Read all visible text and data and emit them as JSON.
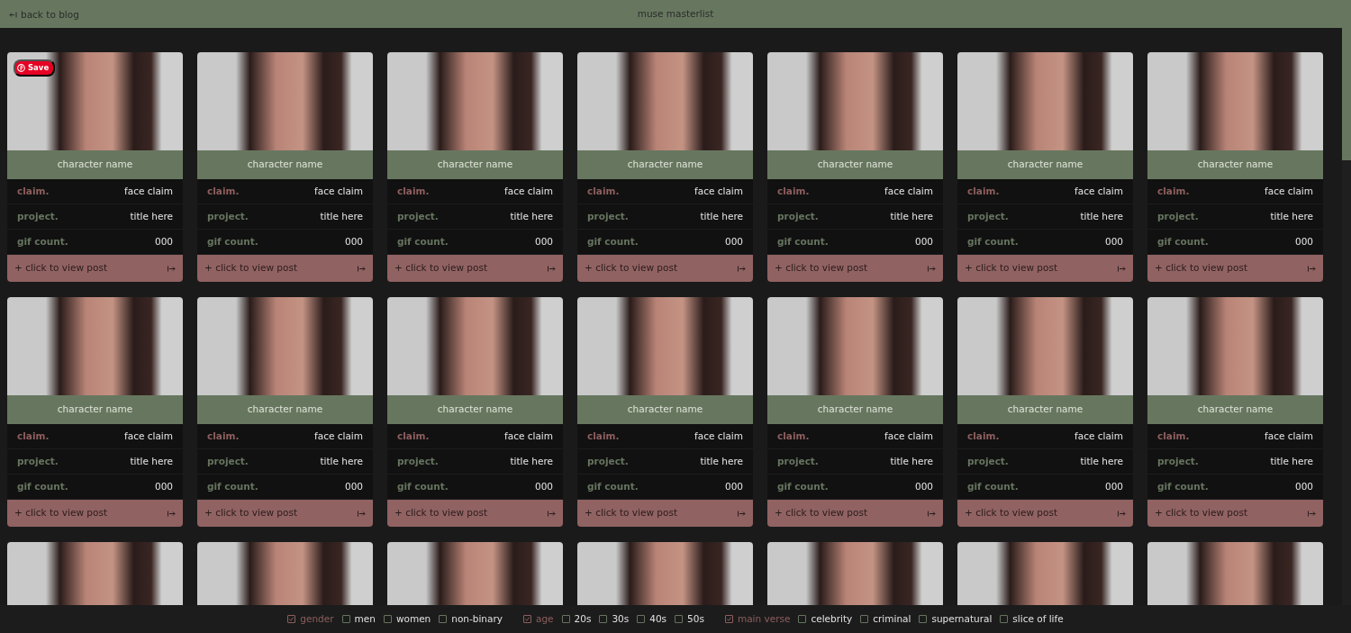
{
  "header": {
    "back_link": "back to blog",
    "title": "muse masterlist"
  },
  "pin_save": {
    "label": "Save"
  },
  "cards": [
    {
      "kind": "full",
      "name": "character name",
      "rows": [
        {
          "label": "claim.",
          "value": "face claim",
          "color": "#8e5e5e"
        },
        {
          "label": "project.",
          "value": "title here",
          "color": "#66745f"
        },
        {
          "label": "gif count.",
          "value": "000",
          "color": "#66745f"
        }
      ],
      "link": "+ click to view post"
    },
    {
      "kind": "full",
      "name": "character name",
      "rows": [
        {
          "label": "claim.",
          "value": "face claim",
          "color": "#8e5e5e"
        },
        {
          "label": "project.",
          "value": "title here",
          "color": "#66745f"
        },
        {
          "label": "gif count.",
          "value": "000",
          "color": "#66745f"
        }
      ],
      "link": "+ click to view post"
    },
    {
      "kind": "full",
      "name": "character name",
      "rows": [
        {
          "label": "claim.",
          "value": "face claim",
          "color": "#8e5e5e"
        },
        {
          "label": "project.",
          "value": "title here",
          "color": "#66745f"
        },
        {
          "label": "gif count.",
          "value": "000",
          "color": "#66745f"
        }
      ],
      "link": "+ click to view post"
    },
    {
      "kind": "full",
      "name": "character name",
      "rows": [
        {
          "label": "claim.",
          "value": "face claim",
          "color": "#8e5e5e"
        },
        {
          "label": "project.",
          "value": "title here",
          "color": "#66745f"
        },
        {
          "label": "gif count.",
          "value": "000",
          "color": "#66745f"
        }
      ],
      "link": "+ click to view post"
    },
    {
      "kind": "full",
      "name": "character name",
      "rows": [
        {
          "label": "claim.",
          "value": "face claim",
          "color": "#8e5e5e"
        },
        {
          "label": "project.",
          "value": "title here",
          "color": "#66745f"
        },
        {
          "label": "gif count.",
          "value": "000",
          "color": "#66745f"
        }
      ],
      "link": "+ click to view post"
    },
    {
      "kind": "full",
      "name": "character name",
      "rows": [
        {
          "label": "claim.",
          "value": "face claim",
          "color": "#8e5e5e"
        },
        {
          "label": "project.",
          "value": "title here",
          "color": "#66745f"
        },
        {
          "label": "gif count.",
          "value": "000",
          "color": "#66745f"
        }
      ],
      "link": "+ click to view post"
    },
    {
      "kind": "full",
      "name": "character name",
      "rows": [
        {
          "label": "claim.",
          "value": "face claim",
          "color": "#8e5e5e"
        },
        {
          "label": "project.",
          "value": "title here",
          "color": "#66745f"
        },
        {
          "label": "gif count.",
          "value": "000",
          "color": "#66745f"
        }
      ],
      "link": "+ click to view post"
    },
    {
      "kind": "full",
      "name": "character name",
      "rows": [
        {
          "label": "claim.",
          "value": "face claim",
          "color": "#8e5e5e"
        },
        {
          "label": "project.",
          "value": "title here",
          "color": "#66745f"
        },
        {
          "label": "gif count.",
          "value": "000",
          "color": "#66745f"
        }
      ],
      "link": "+ click to view post"
    },
    {
      "kind": "full",
      "name": "character name",
      "rows": [
        {
          "label": "claim.",
          "value": "face claim",
          "color": "#8e5e5e"
        },
        {
          "label": "project.",
          "value": "title here",
          "color": "#66745f"
        },
        {
          "label": "gif count.",
          "value": "000",
          "color": "#66745f"
        }
      ],
      "link": "+ click to view post"
    },
    {
      "kind": "full",
      "name": "character name",
      "rows": [
        {
          "label": "claim.",
          "value": "face claim",
          "color": "#8e5e5e"
        },
        {
          "label": "project.",
          "value": "title here",
          "color": "#66745f"
        },
        {
          "label": "gif count.",
          "value": "000",
          "color": "#66745f"
        }
      ],
      "link": "+ click to view post"
    },
    {
      "kind": "full",
      "name": "character name",
      "rows": [
        {
          "label": "claim.",
          "value": "face claim",
          "color": "#8e5e5e"
        },
        {
          "label": "project.",
          "value": "title here",
          "color": "#66745f"
        },
        {
          "label": "gif count.",
          "value": "000",
          "color": "#66745f"
        }
      ],
      "link": "+ click to view post"
    },
    {
      "kind": "full",
      "name": "character name",
      "rows": [
        {
          "label": "claim.",
          "value": "face claim",
          "color": "#8e5e5e"
        },
        {
          "label": "project.",
          "value": "title here",
          "color": "#66745f"
        },
        {
          "label": "gif count.",
          "value": "000",
          "color": "#66745f"
        }
      ],
      "link": "+ click to view post"
    },
    {
      "kind": "full",
      "name": "character name",
      "rows": [
        {
          "label": "claim.",
          "value": "face claim",
          "color": "#8e5e5e"
        },
        {
          "label": "project.",
          "value": "title here",
          "color": "#66745f"
        },
        {
          "label": "gif count.",
          "value": "000",
          "color": "#66745f"
        }
      ],
      "link": "+ click to view post"
    },
    {
      "kind": "full",
      "name": "character name",
      "rows": [
        {
          "label": "claim.",
          "value": "face claim",
          "color": "#8e5e5e"
        },
        {
          "label": "project.",
          "value": "title here",
          "color": "#66745f"
        },
        {
          "label": "gif count.",
          "value": "000",
          "color": "#66745f"
        }
      ],
      "link": "+ click to view post"
    },
    {
      "kind": "photo_only"
    },
    {
      "kind": "photo_only"
    },
    {
      "kind": "photo_only"
    },
    {
      "kind": "photo_only"
    },
    {
      "kind": "photo_only"
    },
    {
      "kind": "photo_only"
    },
    {
      "kind": "photo_only"
    }
  ],
  "filters": [
    {
      "kind": "group",
      "label": "gender",
      "checked": true
    },
    {
      "kind": "option",
      "label": "men",
      "checked": false
    },
    {
      "kind": "option",
      "label": "women",
      "checked": false
    },
    {
      "kind": "option",
      "label": "non-binary",
      "checked": false
    },
    {
      "kind": "group",
      "label": "age",
      "checked": true
    },
    {
      "kind": "option",
      "label": "20s",
      "checked": false
    },
    {
      "kind": "option",
      "label": "30s",
      "checked": false
    },
    {
      "kind": "option",
      "label": "40s",
      "checked": false
    },
    {
      "kind": "option",
      "label": "50s",
      "checked": false
    },
    {
      "kind": "group",
      "label": "main verse",
      "checked": true
    },
    {
      "kind": "option",
      "label": "celebrity",
      "checked": false
    },
    {
      "kind": "option",
      "label": "criminal",
      "checked": false
    },
    {
      "kind": "option",
      "label": "supernatural",
      "checked": false
    },
    {
      "kind": "option",
      "label": "slice of life",
      "checked": false
    }
  ]
}
